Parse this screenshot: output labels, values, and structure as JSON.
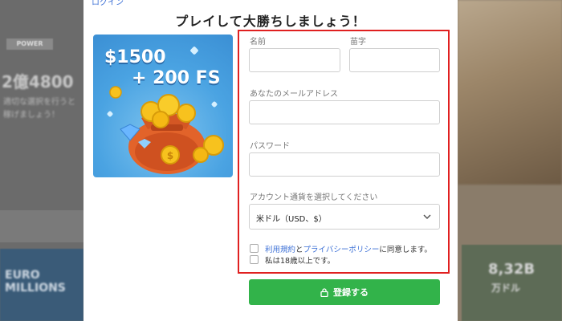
{
  "background": {
    "brand": "POWER",
    "big_text": "2億4800",
    "small_text_1": "適切な選択を行うと",
    "small_text_2": "稼げましょう！",
    "right_amount": "8,32B",
    "right_unit": "万ドル",
    "left_card_text": "EURO\nMILLIONS"
  },
  "modal": {
    "top_link": "ログイン",
    "title": "プレイして大勝ちしましょう！",
    "promo": {
      "line1": "$1500",
      "line2": "+ 200 FS"
    },
    "form": {
      "first_name_label": "名前",
      "first_name_value": "",
      "last_name_label": "苗字",
      "last_name_value": "",
      "email_label": "あなたのメールアドレス",
      "email_value": "",
      "password_label": "パスワード",
      "password_value": "",
      "currency_label": "アカウント通貨を選択してください",
      "currency_selected": "米ドル（USD、$）",
      "terms_link": "利用規約",
      "terms_and": "と",
      "privacy_link": "プライバシーポリシー",
      "terms_suffix": "に同意します。",
      "age_text": "私は18歳以上です。"
    },
    "register_label": "登録する"
  },
  "colors": {
    "accent_green": "#32b34a",
    "link_blue": "#3b6fd6",
    "highlight_red": "#e02020"
  },
  "icons": {
    "register": "lock-icon",
    "currency": "chevron-down-icon"
  }
}
